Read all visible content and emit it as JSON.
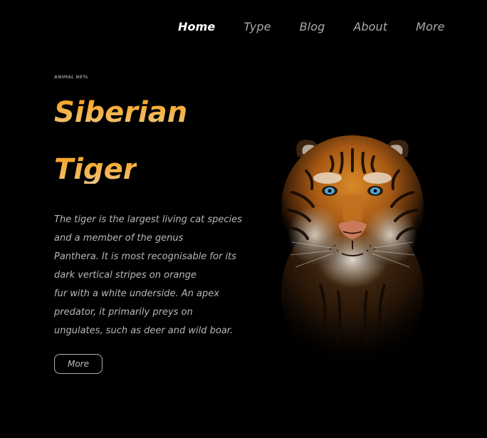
{
  "nav": {
    "items": [
      {
        "label": "Home",
        "active": true
      },
      {
        "label": "Type",
        "active": false
      },
      {
        "label": "Blog",
        "active": false
      },
      {
        "label": "About",
        "active": false
      },
      {
        "label": "More",
        "active": false
      }
    ]
  },
  "hero": {
    "brand": "ANIMAL NETs",
    "title_line1": "Siberian",
    "title_line2": "Tiger",
    "description_lines": [
      "The tiger is the largest living cat species",
      "and a member of the genus",
      "Panthera. It is most recognisable for its",
      "dark vertical stripes on orange",
      "fur with a white underside. An apex",
      "predator, it primarily preys on",
      "ungulates, such as deer and wild boar."
    ],
    "button_label": "More",
    "image_subject": "tiger-portrait"
  },
  "colors": {
    "background": "#000000",
    "title_gradient_start": "#f6a31f",
    "title_gradient_end": "#e9c38c",
    "nav_active": "#ffffff",
    "nav_inactive": "#a9a9a9",
    "body_text": "#b7b7b7"
  }
}
